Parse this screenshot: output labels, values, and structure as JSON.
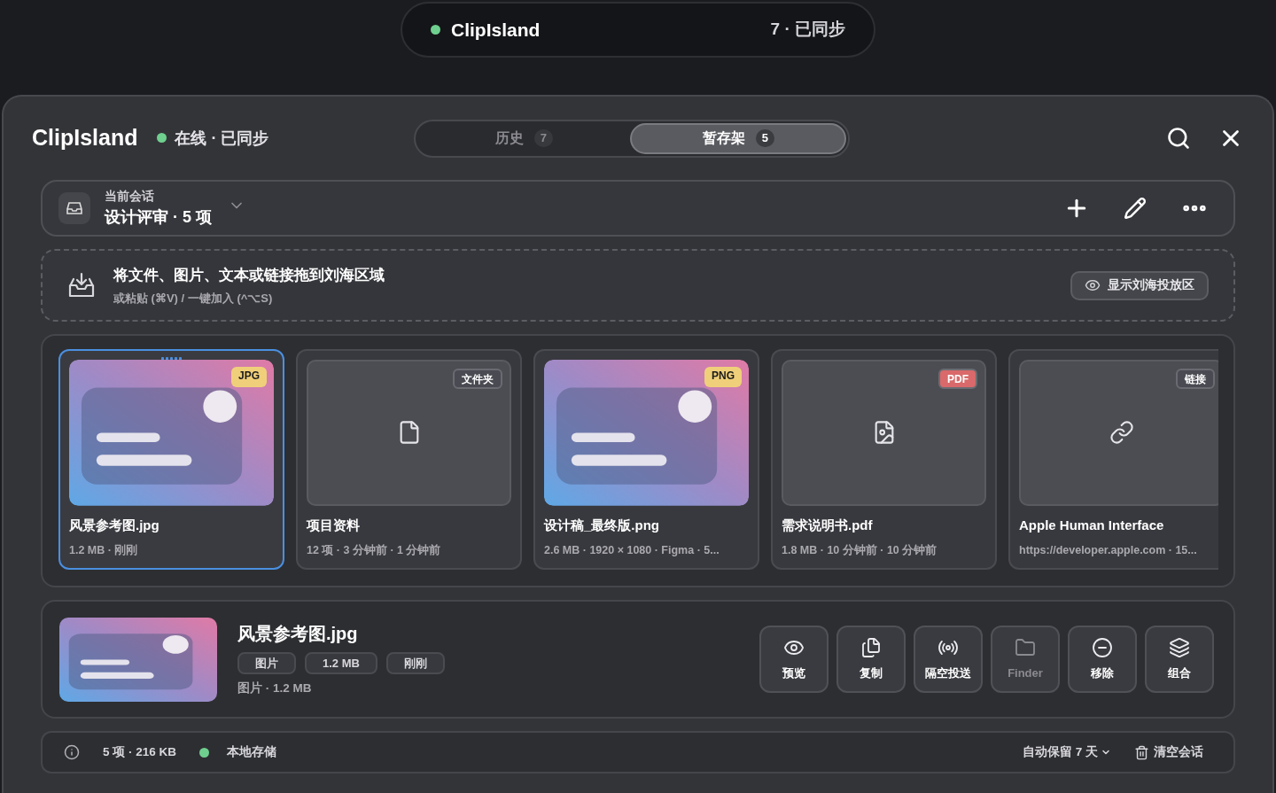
{
  "island": {
    "title": "ClipIsland",
    "status": "7 · 已同步",
    "online": true
  },
  "header": {
    "title": "ClipIsland",
    "status": "在线 · 已同步",
    "online": true
  },
  "tabs": [
    {
      "label": "历史",
      "count": "7",
      "selected": false
    },
    {
      "label": "暂存架",
      "count": "5",
      "selected": true
    }
  ],
  "session": {
    "label": "当前会话",
    "name": "设计评审 · 5 项"
  },
  "drop_zone": {
    "title": "将文件、图片、文本或链接拖到刘海区域",
    "hint": "或粘贴 (⌘V) / 一键加入 (^⌥S)",
    "button": "显示刘海投放区"
  },
  "items": [
    {
      "badge": "JPG",
      "color": "#f0cf7a",
      "name": "风景参考图.jpg",
      "meta": "1.2 MB · 刚刚",
      "selected": true
    },
    {
      "kind": "folder",
      "badge": "文件夹",
      "color": "#4a4b52",
      "name": "项目资料",
      "meta": "12 项 · 3 分钟前 · 1 分钟前",
      "selected": false
    },
    {
      "badge": "PNG",
      "color": "#f0cf7a",
      "name": "设计稿_最终版.png",
      "meta": "2.6 MB · 1920 × 1080 · Figma · 5...",
      "selected": false
    },
    {
      "kind": "pdf",
      "badge": "PDF",
      "color": "#d9696a",
      "name": "需求说明书.pdf",
      "meta": "1.8 MB · 10 分钟前 · 10 分钟前",
      "selected": false
    },
    {
      "kind": "link",
      "badge": "链接",
      "color": "#4a4b52",
      "name": "Apple Human Interface",
      "meta": "https://developer.apple.com · 15...",
      "selected": false
    }
  ],
  "detail": {
    "name": "风景参考图.jpg",
    "tags": [
      "图片",
      "1.2 MB",
      "刚刚"
    ],
    "summary": "图片 · 1.2 MB"
  },
  "actions": [
    {
      "kind": "preview",
      "label": "预览",
      "disabled": false
    },
    {
      "kind": "copy",
      "label": "复制",
      "disabled": false
    },
    {
      "kind": "airdrop",
      "label": "隔空投送",
      "disabled": false
    },
    {
      "kind": "finder",
      "label": "Finder",
      "disabled": true
    },
    {
      "kind": "remove",
      "label": "移除",
      "disabled": false
    },
    {
      "kind": "group",
      "label": "组合",
      "disabled": false
    }
  ],
  "status_bar": {
    "count": "5 项 · 216 KB",
    "storage": "本地存储",
    "storage_on": true,
    "retention": "自动保留 7 天",
    "clear": "清空会话"
  }
}
